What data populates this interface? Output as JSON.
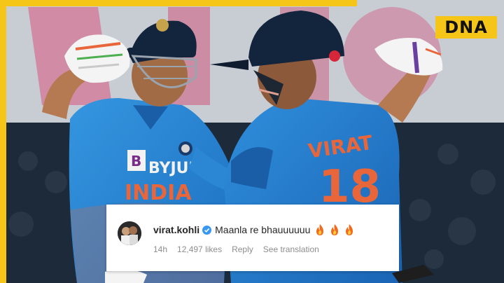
{
  "brand": {
    "logo_text": "DNA",
    "accent_color": "#f5c518"
  },
  "jerseys": {
    "left_sponsor": "BYJU'S",
    "left_country": "INDIA",
    "right_name": "VIRAT",
    "right_number": "18"
  },
  "comment": {
    "username": "virat.kohli",
    "verified": true,
    "text": "Maanla re bhauuuuuu",
    "emoji": [
      "fire-emoji",
      "fire-emoji",
      "fire-emoji"
    ],
    "time": "14h",
    "likes": "12,497 likes",
    "reply_label": "Reply",
    "translation_label": "See translation"
  },
  "colors": {
    "jersey_blue": "#2a84d4",
    "jersey_orange": "#e8663a",
    "helmet_navy": "#13243d",
    "verified_blue": "#3897f0"
  }
}
